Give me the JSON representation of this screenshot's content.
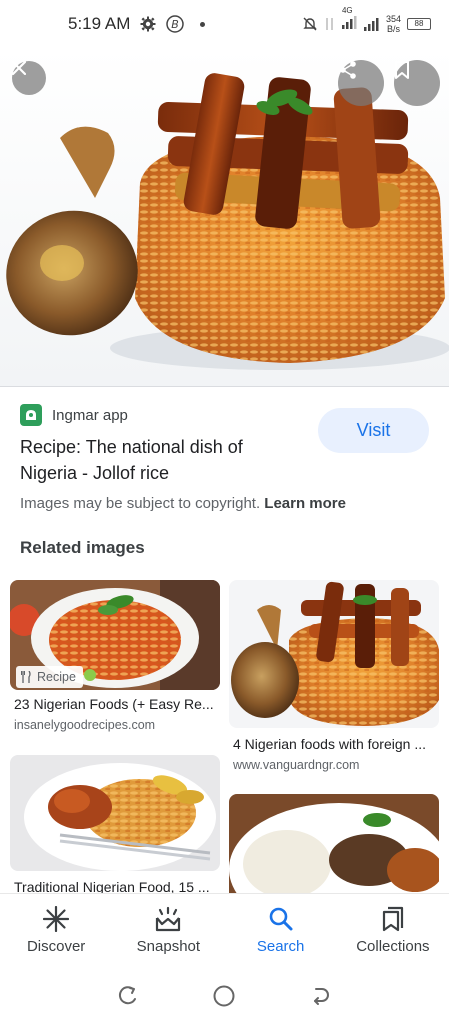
{
  "status_bar": {
    "time": "5:19 AM",
    "network_type": "4G",
    "net_speed_value": "354",
    "net_speed_unit": "B/s",
    "battery": "88"
  },
  "hero": {
    "close_icon": "close-icon",
    "share_icon": "share-icon",
    "save_icon": "bookmark-icon"
  },
  "result": {
    "source_name": "Ingmar app",
    "title": "Recipe: The national dish of Nigeria - Jollof rice",
    "visit_label": "Visit",
    "copyright_text": "Images may be subject to copyright.",
    "learn_more": "Learn more"
  },
  "related": {
    "heading": "Related images",
    "items": [
      {
        "badge": "Recipe",
        "title": "23 Nigerian Foods (+ Easy Re...",
        "source": "insanelygoodrecipes.com"
      },
      {
        "title": "4 Nigerian foods with foreign ...",
        "source": "www.vanguardngr.com"
      },
      {
        "title": "Traditional Nigerian Food, 15 ...",
        "source": ""
      },
      {
        "title": "",
        "source": ""
      }
    ]
  },
  "bottom_nav": [
    {
      "label": "Discover",
      "icon": "asterisk-icon"
    },
    {
      "label": "Snapshot",
      "icon": "snapshot-icon"
    },
    {
      "label": "Search",
      "icon": "search-icon",
      "active": true
    },
    {
      "label": "Collections",
      "icon": "collections-icon"
    }
  ],
  "colors": {
    "accent": "#1a73e8",
    "visit_bg": "#e8f0fe",
    "favicon": "#2e9e5b"
  }
}
